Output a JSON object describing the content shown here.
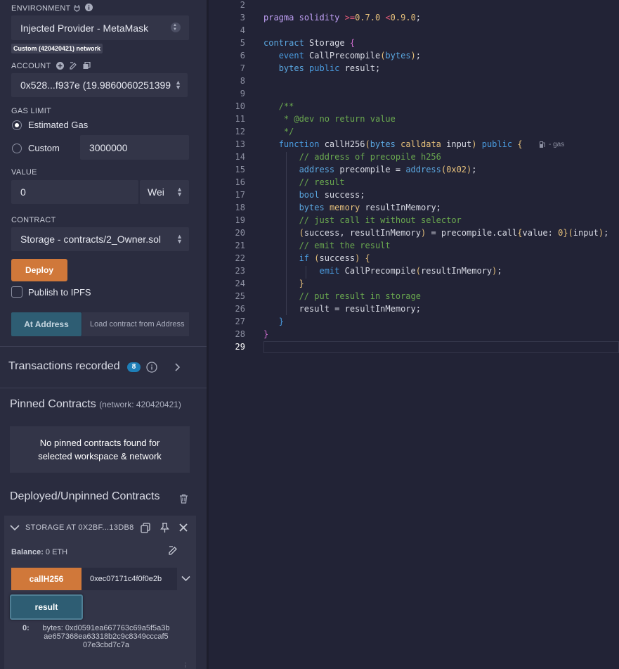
{
  "environment": {
    "label": "ENVIRONMENT",
    "value": "Injected Provider - MetaMask",
    "network_badge": "Custom (420420421) network"
  },
  "account": {
    "label": "ACCOUNT",
    "value": "0x528...f937e (19.9860060251399"
  },
  "gas_limit": {
    "label": "GAS LIMIT",
    "estimated_label": "Estimated Gas",
    "custom_label": "Custom",
    "custom_value": "3000000",
    "selected": "estimated"
  },
  "value": {
    "label": "VALUE",
    "amount": "0",
    "unit": "Wei"
  },
  "contract": {
    "label": "CONTRACT",
    "value": "Storage - contracts/2_Owner.sol",
    "deploy_label": "Deploy",
    "publish_label": "Publish to IPFS",
    "at_address_label": "At Address",
    "load_placeholder": "Load contract from Address"
  },
  "transactions": {
    "label": "Transactions recorded",
    "count": "8"
  },
  "pinned": {
    "title": "Pinned Contracts",
    "network": "(network: 420420421)",
    "empty_line1": "No pinned contracts found for",
    "empty_line2": "selected workspace & network"
  },
  "deployed": {
    "title": "Deployed/Unpinned Contracts",
    "instance_name": "STORAGE AT 0X2BF...13DB8",
    "balance_label": "Balance:",
    "balance_value": "0 ETH",
    "call_button": "callH256",
    "call_input": "0xec07171c4f0f0e2b",
    "result_button": "result",
    "result_index": "0:",
    "result_line1": "bytes: 0xd0591ea667763c69a5f5a3b",
    "result_line2": "ae657368ea63318b2c9c8349cccaf5",
    "result_line3": "07e3cbd7c7a"
  },
  "editor": {
    "gas_hint": "- gas",
    "line_numbers": [
      "2",
      "3",
      "4",
      "5",
      "6",
      "7",
      "8",
      "9",
      "10",
      "11",
      "12",
      "13",
      "14",
      "15",
      "16",
      "17",
      "18",
      "19",
      "20",
      "21",
      "22",
      "23",
      "24",
      "25",
      "26",
      "27",
      "28",
      "29"
    ]
  },
  "colors": {
    "accent_orange": "#d0783a",
    "accent_teal": "#2e5d73",
    "badge_blue": "#1e7fb8"
  }
}
